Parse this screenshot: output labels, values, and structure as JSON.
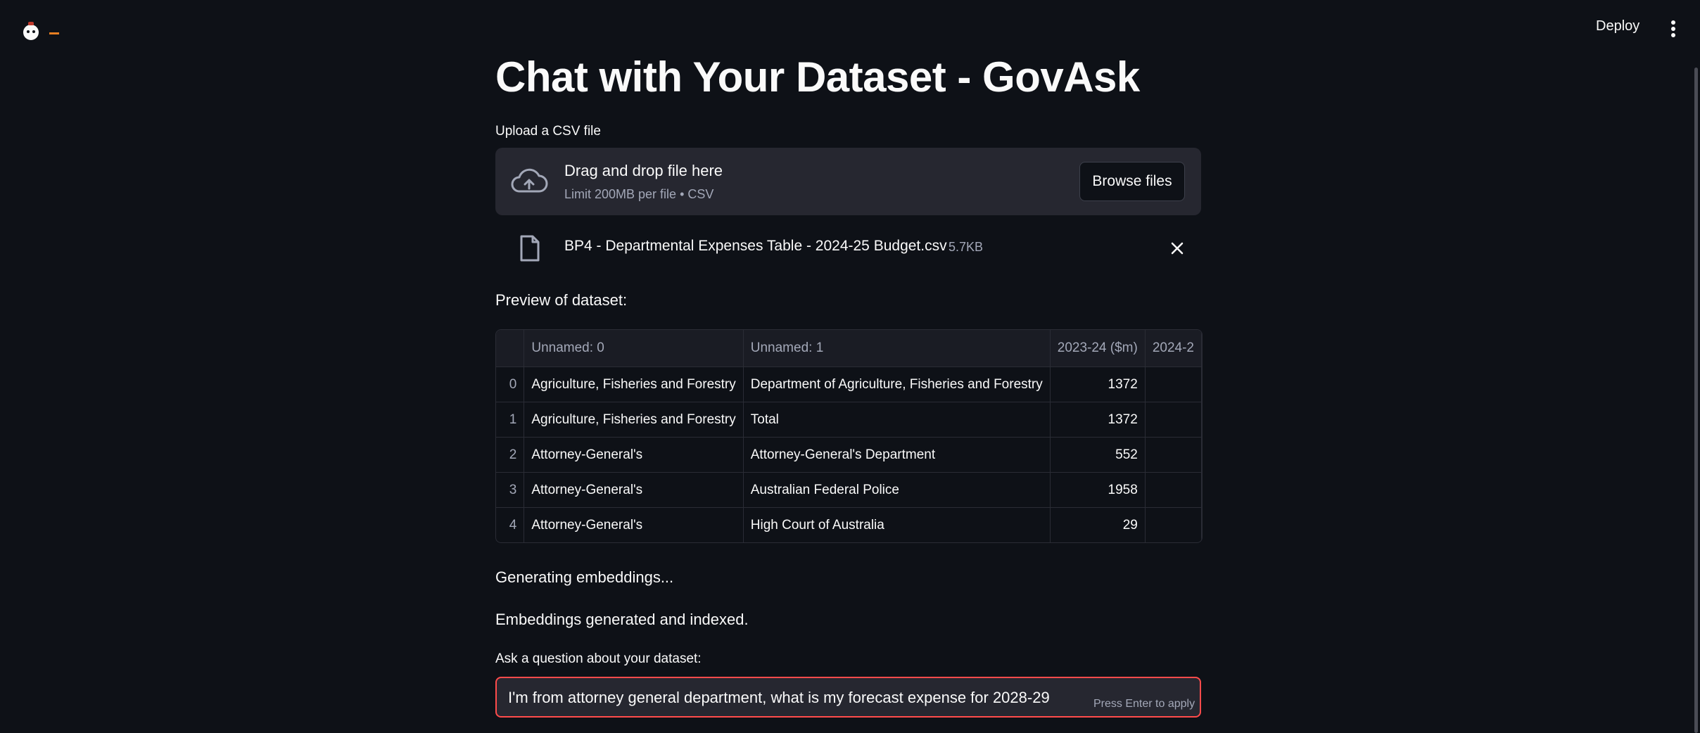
{
  "header": {
    "deploy_label": "Deploy",
    "menu_icon": "kebab-menu-icon"
  },
  "page": {
    "title": "Chat with Your Dataset - GovAsk"
  },
  "upload": {
    "label": "Upload a CSV file",
    "dropzone_title": "Drag and drop file here",
    "dropzone_subtitle": "Limit 200MB per file • CSV",
    "browse_label": "Browse files",
    "file_name": "BP4 - Departmental Expenses Table - 2024-25 Budget.csv",
    "file_size": "5.7KB"
  },
  "preview": {
    "label": "Preview of dataset:",
    "columns": [
      "",
      "Unnamed: 0",
      "Unnamed: 1",
      "2023-24 ($m)",
      "2024-2"
    ],
    "rows": [
      {
        "index": "0",
        "c0": "Agriculture, Fisheries and Forestry",
        "c1": "Department of Agriculture, Fisheries and Forestry",
        "c2": "1372",
        "c3": ""
      },
      {
        "index": "1",
        "c0": "Agriculture, Fisheries and Forestry",
        "c1": "Total",
        "c2": "1372",
        "c3": ""
      },
      {
        "index": "2",
        "c0": "Attorney-General's",
        "c1": "Attorney-General's Department",
        "c2": "552",
        "c3": ""
      },
      {
        "index": "3",
        "c0": "Attorney-General's",
        "c1": "Australian Federal Police",
        "c2": "1958",
        "c3": ""
      },
      {
        "index": "4",
        "c0": "Attorney-General's",
        "c1": "High Court of Australia",
        "c2": "29",
        "c3": ""
      }
    ]
  },
  "status": {
    "generating": "Generating embeddings...",
    "done": "Embeddings generated and indexed."
  },
  "question": {
    "label": "Ask a question about your dataset:",
    "value": "I'm from attorney general department, what is my forecast expense for 2028-29",
    "hint": "Press Enter to apply"
  },
  "colors": {
    "background": "#0e1117",
    "surface": "#262730",
    "accent_focus": "#ff4b4b",
    "muted_text": "#a3a8b8"
  }
}
